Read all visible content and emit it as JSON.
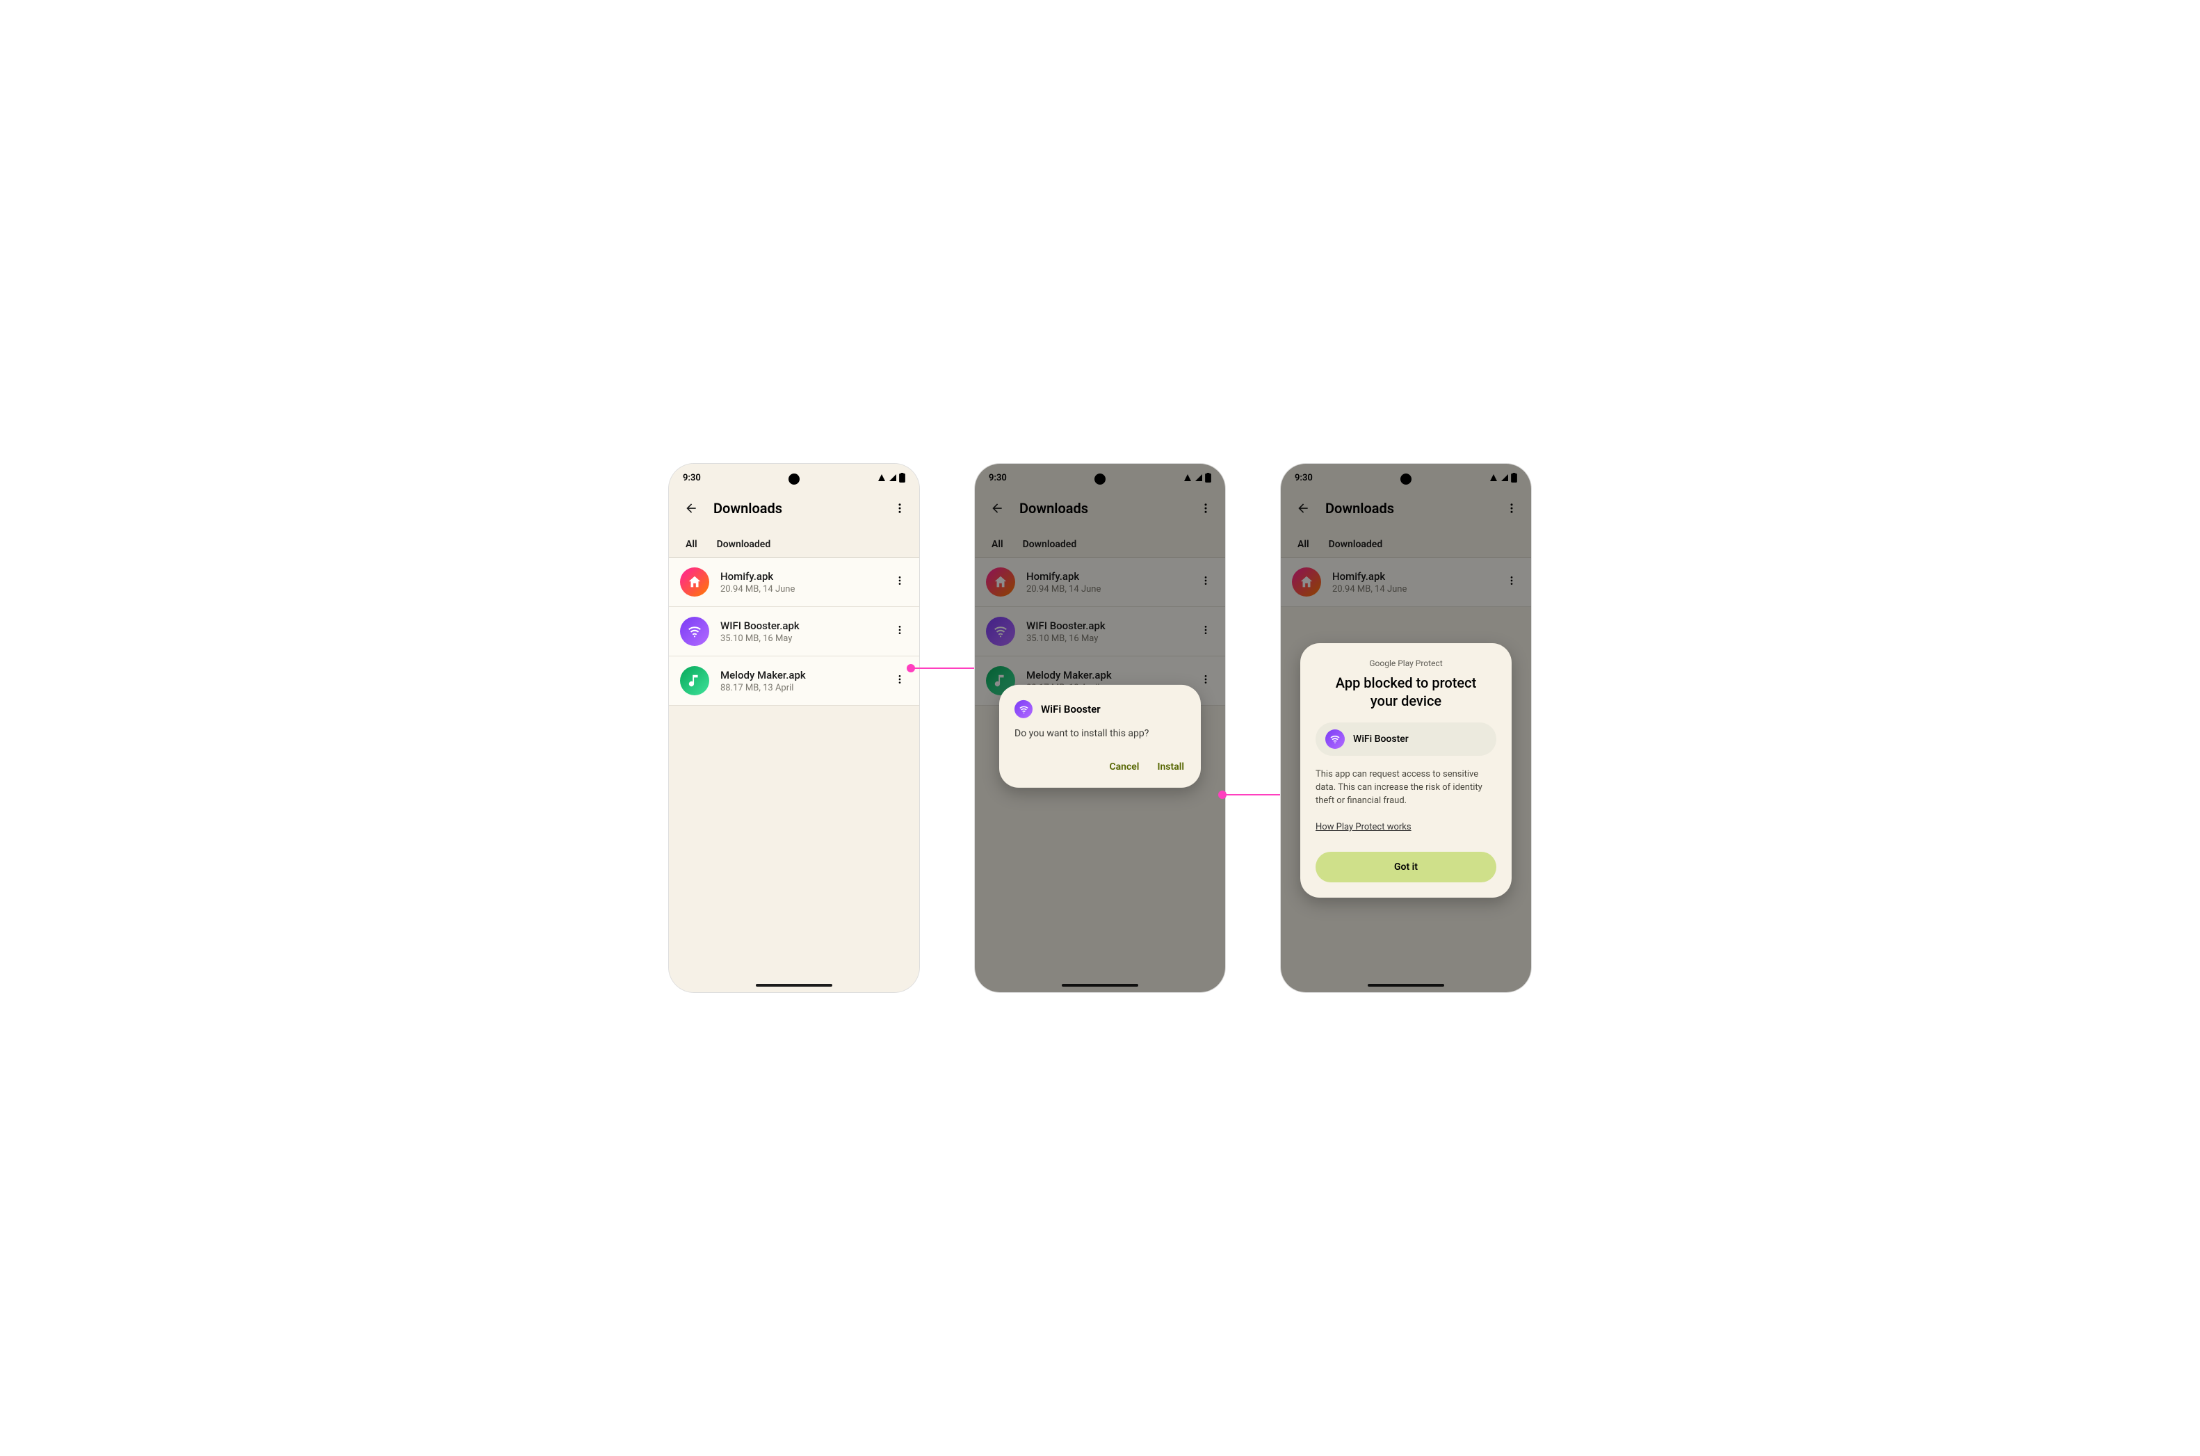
{
  "status": {
    "time": "9:30"
  },
  "header": {
    "title": "Downloads"
  },
  "tabs": {
    "all": "All",
    "downloaded": "Downloaded"
  },
  "files": [
    {
      "name": "Homify.apk",
      "sub": "20.94 MB, 14 June"
    },
    {
      "name": "WIFI Booster.apk",
      "sub": "35.10 MB, 16 May"
    },
    {
      "name": "Melody Maker.apk",
      "sub": "88.17 MB, 13 April"
    }
  ],
  "install_dialog": {
    "app_name": "WiFi Booster",
    "body": "Do you want to install this app?",
    "cancel": "Cancel",
    "install": "Install"
  },
  "block_dialog": {
    "eyebrow": "Google Play Protect",
    "title": "App blocked to protect your device",
    "app_name": "WiFi Booster",
    "explanation": "This app can request access to sensitive data. This can increase the risk of identity theft or financial fraud.",
    "link": "How Play Protect works",
    "confirm": "Got it"
  }
}
